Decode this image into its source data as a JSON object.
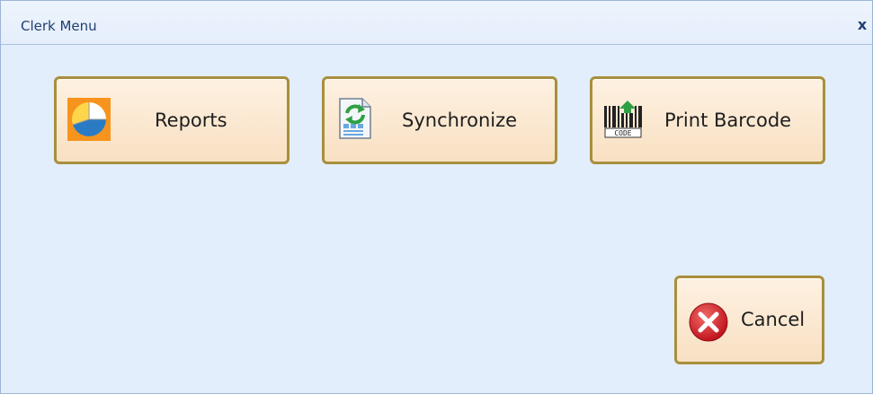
{
  "window": {
    "title": "Clerk Menu",
    "close_glyph": "x"
  },
  "buttons": {
    "reports": {
      "label": "Reports",
      "icon": "pie-chart-icon"
    },
    "synchronize": {
      "label": "Synchronize",
      "icon": "sync-document-icon"
    },
    "print_barcode": {
      "label": "Print Barcode",
      "icon": "barcode-icon",
      "icon_text": "CODE"
    },
    "cancel": {
      "label": "Cancel",
      "icon": "cancel-icon"
    }
  },
  "colors": {
    "window_background": "#e2eefc",
    "title_text": "#1f3f6e",
    "button_border": "#a88f3d",
    "button_fill": "#fbe8d1"
  }
}
